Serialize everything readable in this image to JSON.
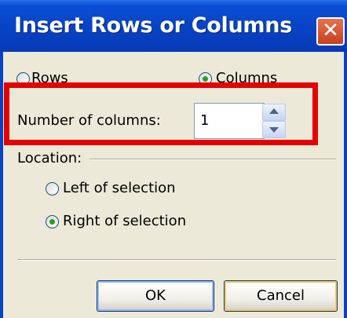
{
  "dialog": {
    "title": "Insert Rows or Columns",
    "close_glyph": "✕"
  },
  "type_options": [
    {
      "label": "Rows",
      "checked": false
    },
    {
      "label": "Columns",
      "checked": true
    }
  ],
  "count": {
    "label": "Number of columns:",
    "value": "1"
  },
  "location": {
    "group_label": "Location:",
    "options": [
      {
        "label": "Left of selection",
        "checked": false
      },
      {
        "label": "Right of selection",
        "checked": true
      }
    ]
  },
  "buttons": {
    "ok": "OK",
    "cancel": "Cancel"
  },
  "colors": {
    "title_bar": "#0842c4",
    "highlight": "#e30000",
    "radio_selected": "#21a121"
  }
}
